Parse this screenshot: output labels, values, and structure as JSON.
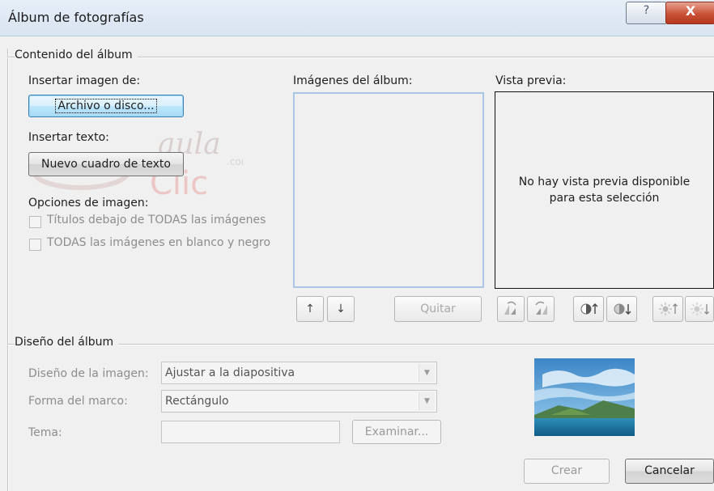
{
  "window": {
    "title": "Álbum de fotografías",
    "help_label": "?",
    "close_label": "X"
  },
  "album_content": {
    "group_title": "Contenido del álbum",
    "insert_image_label": "Insertar imagen de:",
    "file_button": "Archivo o disco...",
    "insert_text_label": "Insertar texto:",
    "text_box_button": "Nuevo cuadro de texto",
    "image_options_label": "Opciones de imagen:",
    "option_captions": "Títulos debajo de TODAS las imágenes",
    "option_bw": "TODAS las imágenes en blanco y negro",
    "album_images_label": "Imágenes del álbum:",
    "preview_label": "Vista previa:",
    "preview_message_line1": "No hay vista previa disponible",
    "preview_message_line2": "para esta selección",
    "remove_button": "Quitar",
    "move_up_symbol": "↑",
    "move_down_symbol": "↓"
  },
  "album_layout": {
    "group_title": "Diseño del álbum",
    "picture_layout_label": "Diseño de la imagen:",
    "picture_layout_value": "Ajustar a la diapositiva",
    "frame_shape_label": "Forma del marco:",
    "frame_shape_value": "Rectángulo",
    "theme_label": "Tema:",
    "browse_button": "Examinar..."
  },
  "footer": {
    "create_button": "Crear",
    "cancel_button": "Cancelar"
  },
  "watermark": {
    "line1": "aula",
    "line2": "Clic",
    "line3": ".com"
  }
}
